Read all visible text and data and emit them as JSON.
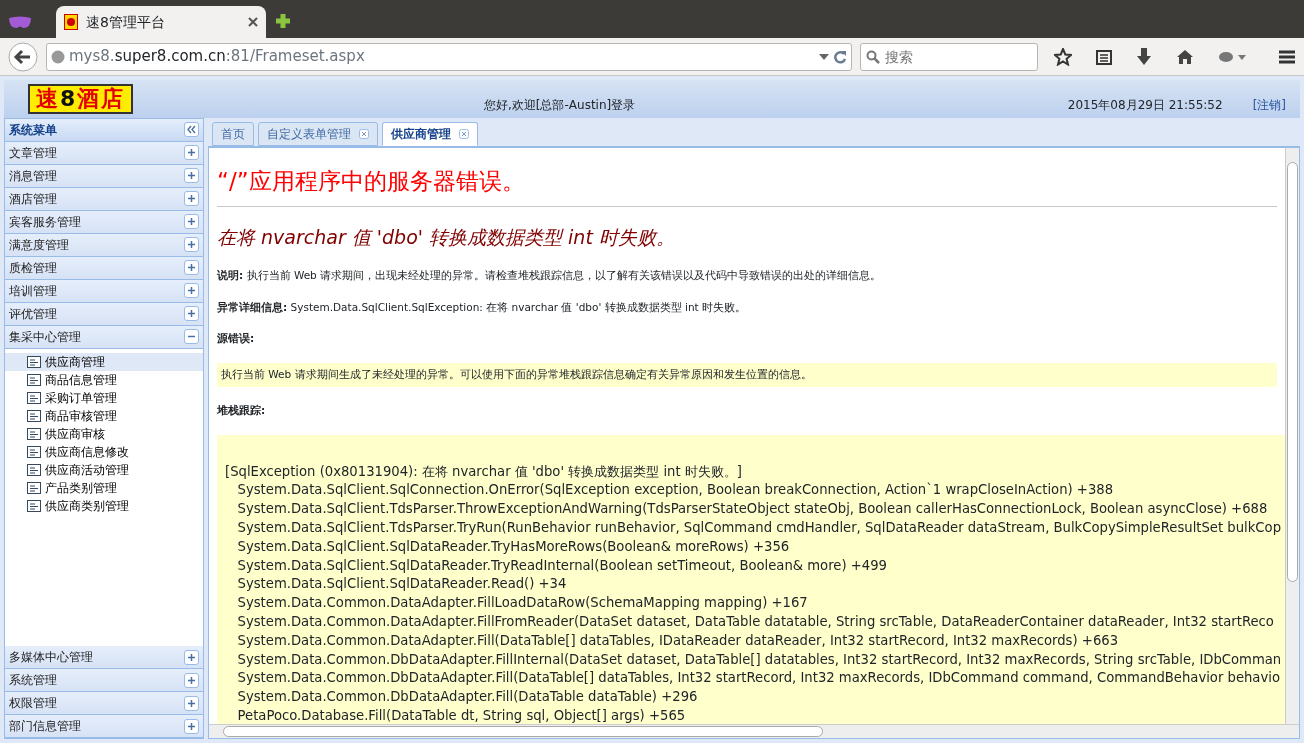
{
  "browser": {
    "tab_title": "速8管理平台",
    "url_host_prefix": "mys8.",
    "url_host": "super8.com.cn",
    "url_path": ":81/Frameset.aspx",
    "search_placeholder": "搜索"
  },
  "header": {
    "logo": {
      "left": "速",
      "number": "8",
      "right": "酒店"
    },
    "welcome": "您好,欢迎[总部-Austin]登录",
    "datetime": "2015年08月29日 21:55:52",
    "logout": "[注销]"
  },
  "sidebar": {
    "title": "系统菜单",
    "sections": [
      {
        "label": "文章管理",
        "expanded": false
      },
      {
        "label": "消息管理",
        "expanded": false
      },
      {
        "label": "酒店管理",
        "expanded": false
      },
      {
        "label": "宾客服务管理",
        "expanded": false
      },
      {
        "label": "满意度管理",
        "expanded": false
      },
      {
        "label": "质检管理",
        "expanded": false
      },
      {
        "label": "培训管理",
        "expanded": false
      },
      {
        "label": "评优管理",
        "expanded": false
      },
      {
        "label": "集采中心管理",
        "expanded": true,
        "children": [
          {
            "label": "供应商管理",
            "selected": true
          },
          {
            "label": "商品信息管理",
            "selected": false
          },
          {
            "label": "采购订单管理",
            "selected": false
          },
          {
            "label": "商品审核管理",
            "selected": false
          },
          {
            "label": "供应商审核",
            "selected": false
          },
          {
            "label": "供应商信息修改",
            "selected": false
          },
          {
            "label": "供应商活动管理",
            "selected": false
          },
          {
            "label": "产品类别管理",
            "selected": false
          },
          {
            "label": "供应商类别管理",
            "selected": false
          }
        ]
      },
      {
        "label": "多媒体中心管理",
        "expanded": false
      },
      {
        "label": "系统管理",
        "expanded": false
      },
      {
        "label": "权限管理",
        "expanded": false
      },
      {
        "label": "部门信息管理",
        "expanded": false
      }
    ]
  },
  "tabs": [
    {
      "label": "首页",
      "selected": false,
      "closable": false
    },
    {
      "label": "自定义表单管理",
      "selected": false,
      "closable": true
    },
    {
      "label": "供应商管理",
      "selected": true,
      "closable": true
    }
  ],
  "error": {
    "title": "“/”应用程序中的服务器错误。",
    "message": "在将 nvarchar 值 'dbo' 转换成数据类型 int 时失败。",
    "description": "**说明:** 执行当前 Web 请求期间，出现未经处理的异常。请检查堆栈跟踪信息，以了解有关该错误以及代码中导致错误的出处的详细信息。",
    "details": "**异常详细信息:** System.Data.SqlClient.SqlException: 在将 nvarchar 值 'dbo' 转换成数据类型 int 时失败。",
    "source_label": "源错误:",
    "source_text": "执行当前 Web 请求期间生成了未经处理的异常。可以使用下面的异常堆栈跟踪信息确定有关异常原因和发生位置的信息。",
    "stack_label": "堆栈跟踪:",
    "stack_lines": [
      "[SqlException (0x80131904): 在将 nvarchar 值 'dbo' 转换成数据类型 int 时失败。]",
      "   System.Data.SqlClient.SqlConnection.OnError(SqlException exception, Boolean breakConnection, Action`1 wrapCloseInAction) +388",
      "   System.Data.SqlClient.TdsParser.ThrowExceptionAndWarning(TdsParserStateObject stateObj, Boolean callerHasConnectionLock, Boolean asyncClose) +688",
      "   System.Data.SqlClient.TdsParser.TryRun(RunBehavior runBehavior, SqlCommand cmdHandler, SqlDataReader dataStream, BulkCopySimpleResultSet bulkCop",
      "   System.Data.SqlClient.SqlDataReader.TryHasMoreRows(Boolean& moreRows) +356",
      "   System.Data.SqlClient.SqlDataReader.TryReadInternal(Boolean setTimeout, Boolean& more) +499",
      "   System.Data.SqlClient.SqlDataReader.Read() +34",
      "   System.Data.Common.DataAdapter.FillLoadDataRow(SchemaMapping mapping) +167",
      "   System.Data.Common.DataAdapter.FillFromReader(DataSet dataset, DataTable datatable, String srcTable, DataReaderContainer dataReader, Int32 startReco",
      "   System.Data.Common.DataAdapter.Fill(DataTable[] dataTables, IDataReader dataReader, Int32 startRecord, Int32 maxRecords) +663",
      "   System.Data.Common.DbDataAdapter.FillInternal(DataSet dataset, DataTable[] datatables, Int32 startRecord, Int32 maxRecords, String srcTable, IDbComman",
      "   System.Data.Common.DbDataAdapter.Fill(DataTable[] dataTables, Int32 startRecord, Int32 maxRecords, IDbCommand command, CommandBehavior behavio",
      "   System.Data.Common.DbDataAdapter.Fill(DataTable dataTable) +296",
      "   PetaPoco.Database.Fill(DataTable dt, String sql, Object[] args) +565"
    ]
  }
}
